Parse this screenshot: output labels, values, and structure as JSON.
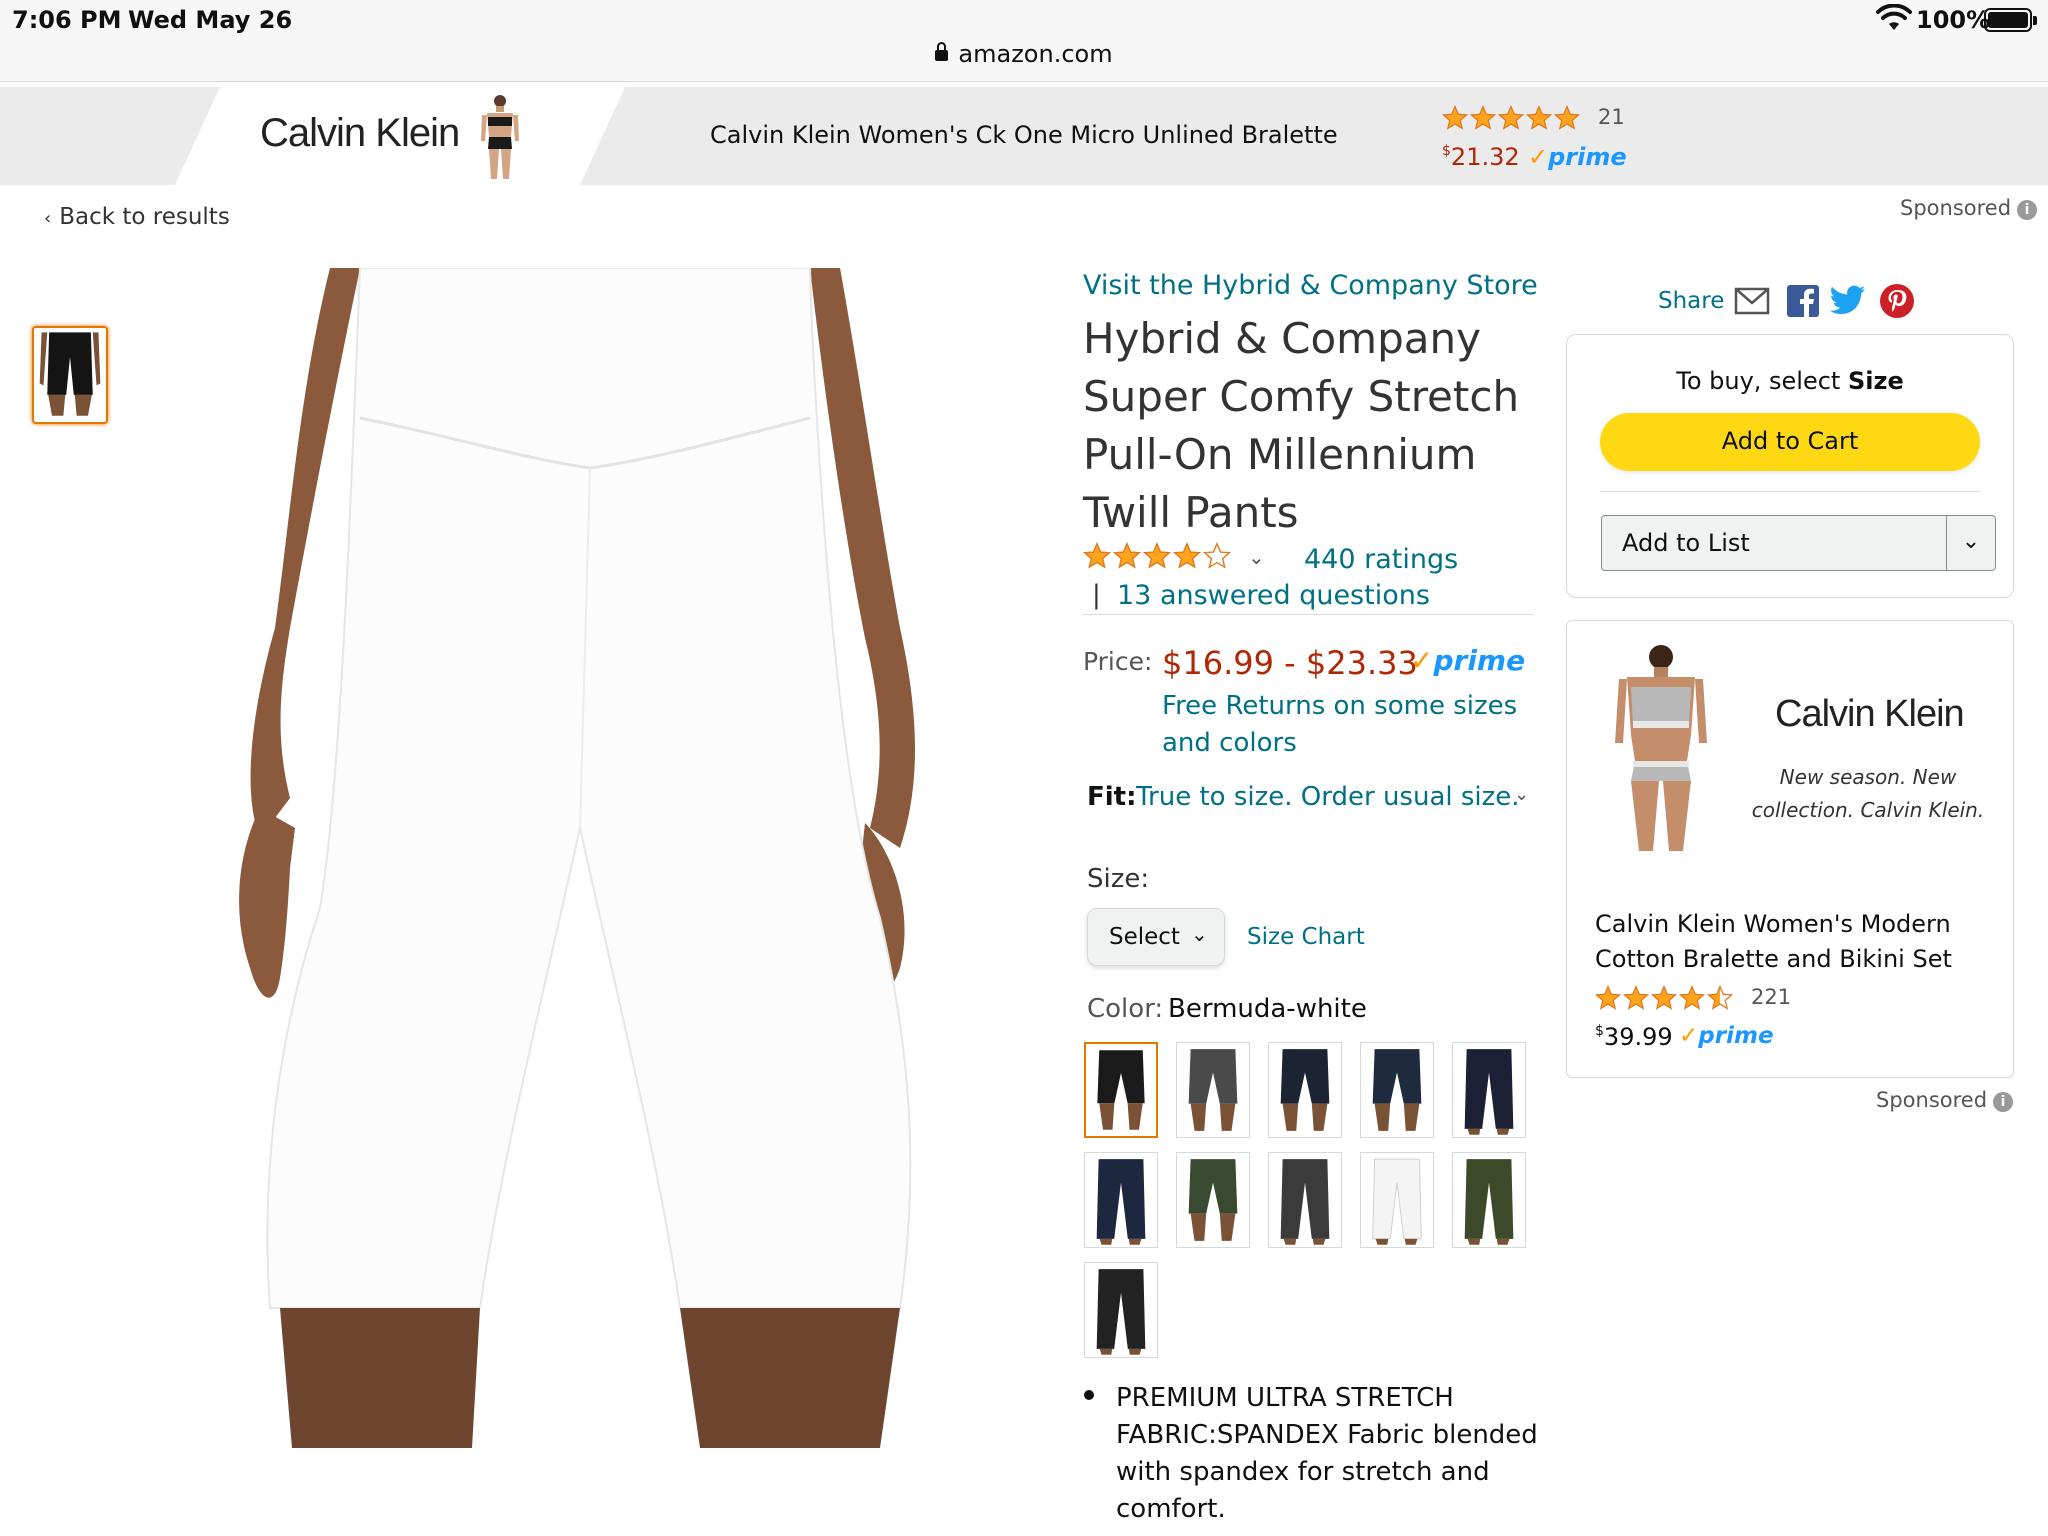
{
  "status_bar": {
    "time": "7:06 PM",
    "date": "Wed May 26",
    "url": "amazon.com",
    "battery": "100%",
    "icons": [
      "lock-icon",
      "wifi-icon",
      "battery-icon"
    ]
  },
  "banner": {
    "brand": "Calvin Klein",
    "product_title": "Calvin Klein Women's Ck One Micro Unlined Bralette",
    "rating_stars": 5,
    "rating_count": "21",
    "price_currency": "$",
    "price": "21.32",
    "prime_label": "prime"
  },
  "nav": {
    "back_label": "Back to results",
    "sponsored_label": "Sponsored"
  },
  "product": {
    "store_link": "Visit the Hybrid & Company Store",
    "title": "Hybrid & Company Super Comfy Stretch Pull-On Millennium Twill Pants",
    "rating_stars": 4,
    "ratings_link": "440 ratings",
    "qa_separator": "|",
    "qa_link": "13 answered questions",
    "price_label": "Price:",
    "price_range": "$16.99 - $23.33",
    "prime_label": "prime",
    "free_returns": "Free Returns on some sizes and colors",
    "fit_label": "Fit:",
    "fit_text": "True to size. Order usual size.",
    "size_label": "Size:",
    "size_select_value": "Select",
    "size_chart_link": "Size Chart",
    "color_label": "Color:",
    "color_value": "Bermuda-white",
    "swatches": [
      {
        "color": "#1a1a1a",
        "style": "bermuda",
        "selected": true
      },
      {
        "color": "#4a4a4a",
        "style": "bermuda",
        "selected": false
      },
      {
        "color": "#1c2433",
        "style": "bermuda",
        "selected": false
      },
      {
        "color": "#1e2b3e",
        "style": "bermuda",
        "selected": false
      },
      {
        "color": "#1b2035",
        "style": "capri",
        "selected": false
      },
      {
        "color": "#1d2740",
        "style": "capri",
        "selected": false
      },
      {
        "color": "#3a4a30",
        "style": "bermuda",
        "selected": false
      },
      {
        "color": "#3b3b3b",
        "style": "capri",
        "selected": false
      },
      {
        "color": "#f4f4f4",
        "style": "capri",
        "selected": false
      },
      {
        "color": "#3d4a2a",
        "style": "capri",
        "selected": false
      },
      {
        "color": "#222222",
        "style": "capri",
        "selected": false
      }
    ],
    "bullets": [
      "PREMIUM ULTRA STRETCH FABRIC:SPANDEX Fabric blended with spandex for stretch and comfort."
    ]
  },
  "share": {
    "label": "Share",
    "icons": [
      "email-icon",
      "facebook-icon",
      "twitter-icon",
      "pinterest-icon"
    ]
  },
  "buybox": {
    "to_buy_prefix": "To buy, select ",
    "to_buy_bold": "Size",
    "add_to_cart": "Add to Cart",
    "add_to_list": "Add to List"
  },
  "ad_card": {
    "brand": "Calvin Klein",
    "tagline": "New season. New collection. Calvin Klein.",
    "title": "Calvin Klein Women's Modern Cotton Bralette and Bikini Set",
    "rating_stars": 4.5,
    "rating_count": "221",
    "price_currency": "$",
    "price": "39.99",
    "prime_label": "prime",
    "sponsored_label": "Sponsored"
  },
  "colors": {
    "link": "#007185",
    "price": "#b12704",
    "star": "#ffa41c",
    "add_to_cart": "#ffd814",
    "prime": "#1a98ff",
    "selected_border": "#e77600"
  }
}
